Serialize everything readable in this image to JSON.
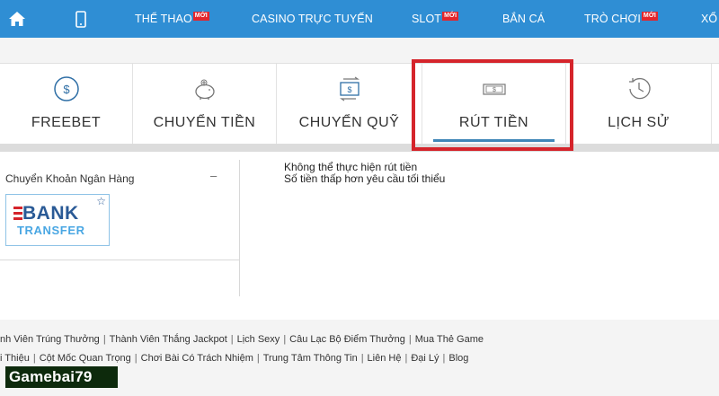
{
  "nav": {
    "items": [
      {
        "label": "THỂ THAO",
        "badge": "MỚI"
      },
      {
        "label": "CASINO TRỰC TUYẾN",
        "badge": ""
      },
      {
        "label": "SLOT",
        "badge": "MỚI"
      },
      {
        "label": "BẮN CÁ",
        "badge": ""
      },
      {
        "label": "TRÒ CHƠI",
        "badge": "MỚI"
      },
      {
        "label": "XỔ",
        "badge": ""
      }
    ]
  },
  "tiles": [
    {
      "label": "FREEBET",
      "icon": "dollar-coin-icon"
    },
    {
      "label": "CHUYỂN TIỀN",
      "icon": "piggy-bank-icon"
    },
    {
      "label": "CHUYỂN QUỸ",
      "icon": "transfer-funds-icon"
    },
    {
      "label": "RÚT TIỀN",
      "icon": "cash-withdraw-icon",
      "active": true
    },
    {
      "label": "LỊCH SỬ",
      "icon": "history-clock-icon"
    }
  ],
  "payment": {
    "title": "Chuyển Khoản Ngân Hàng",
    "collapse": "–",
    "card_word1": "BANK",
    "card_word2": "TRANSFER",
    "star": "☆"
  },
  "message": {
    "line1": "Không thể thực hiện rút tiền",
    "line2": "Số tiền thấp hơn yêu cầu tối thiểu"
  },
  "footer": {
    "row1": [
      "nh Viên Trúng Thưởng",
      "Thành Viên Thắng Jackpot",
      "Lịch Sexy",
      "Câu Lạc Bộ Điểm Thưởng",
      "Mua Thẻ Game"
    ],
    "row2": [
      "i Thiệu",
      "Cột Mốc Quan Trọng",
      "Chơi Bài Có Trách Nhiệm",
      "Trung Tâm Thông Tin",
      "Liên Hệ",
      "Đại Lý",
      "Blog"
    ],
    "separator": "|"
  },
  "watermark": "Gamebai79",
  "colors": {
    "nav": "#2f8ed4",
    "highlight": "#d5242b",
    "underline": "#3f86b8"
  }
}
